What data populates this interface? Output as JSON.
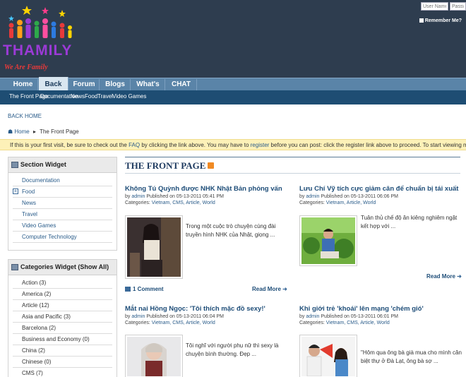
{
  "header": {
    "logo_text": "THAMILY",
    "logo_tagline": "We Are Family",
    "login": {
      "username_placeholder": "User Name",
      "password_placeholder": "Passwo",
      "remember": "Remember Me?"
    }
  },
  "nav": {
    "tabs": [
      {
        "label": "Home"
      },
      {
        "label": "Back"
      },
      {
        "label": "Forum"
      },
      {
        "label": "Blogs"
      },
      {
        "label": "What's New?"
      },
      {
        "label": "CHAT"
      }
    ],
    "subnav": [
      "The Front Page",
      "Documentation",
      "News",
      "Food",
      "Travel",
      "Video Games"
    ]
  },
  "back_home": "BACK HOME",
  "breadcrumb": {
    "home": "Home",
    "current": "The Front Page"
  },
  "notice": {
    "text_1": "If this is your first visit, be sure to check out the ",
    "faq": "FAQ",
    "text_2": " by clicking the link above. You may have to ",
    "register": "register",
    "text_3": " before you can post: click the register link above to proceed. To start viewing messages, select the forum that you"
  },
  "section_widget": {
    "title": "Section Widget",
    "items": [
      "Documentation",
      "Food",
      "News",
      "Travel",
      "Video Games",
      "Computer Technology"
    ]
  },
  "categories_widget": {
    "title": "Categories Widget (Show All)",
    "items": [
      "Action (3)",
      "America (2)",
      "Article (12)",
      "Asia and Pacific (3)",
      "Barcelona (2)",
      "Business and Economy (0)",
      "China (2)",
      "Chinese (0)",
      "CMS (7)"
    ]
  },
  "front_page": {
    "title": "THE FRONT PAGE",
    "posts": [
      {
        "title": "Không Tú Quỳnh được NHK Nhật Bản phỏng vấn",
        "by": "by",
        "author": "admin",
        "published": "Published on 05-13-2011 05:41 PM",
        "categories_label": "Categories:",
        "categories": "Vietnam, CMS, Article, World",
        "excerpt": "Trong một cuộc trò chuyện cùng đài truyền hình NHK của Nhật, giọng ...",
        "comments": "1 Comment",
        "read_more": "Read More"
      },
      {
        "title": "Lưu Chí Vỹ tích cực giảm cân để chuẩn bị tái xuất",
        "by": "by",
        "author": "admin",
        "published": "Published on 05-13-2011 06:06 PM",
        "categories_label": "Categories:",
        "categories": "Vietnam, Article, World",
        "excerpt": "Tuân thủ chế độ ăn kiêng nghiêm ngặt kết hợp với ...",
        "read_more": "Read More"
      },
      {
        "title": "Mắt nai Hồng Ngọc: 'Tôi thích mặc đồ sexy!'",
        "by": "by",
        "author": "admin",
        "published": "Published on 05-13-2011 06:04 PM",
        "categories_label": "Categories:",
        "categories": "Vietnam, CMS, Article, World",
        "excerpt": "Tôi nghĩ với người phụ nữ thì sexy là chuyện bình thường. Đẹp ..."
      },
      {
        "title": "Khi giới trẻ 'khoái' lên mạng 'chém gió'",
        "by": "by",
        "author": "admin",
        "published": "Published on 05-13-2011 06:01 PM",
        "categories_label": "Categories:",
        "categories": "Vietnam, CMS, Article, World",
        "excerpt": "\"Hôm qua ông bà già mua cho mình căn biệt thự ở Đà Lạt, ông bà sợ ..."
      }
    ]
  },
  "colors": {
    "header_bg": "#2e3d4f",
    "nav_bg": "#5a84a8",
    "subnav_bg": "#1e4d73",
    "link": "#1e4d78",
    "notice_bg": "#fdf1b8"
  }
}
